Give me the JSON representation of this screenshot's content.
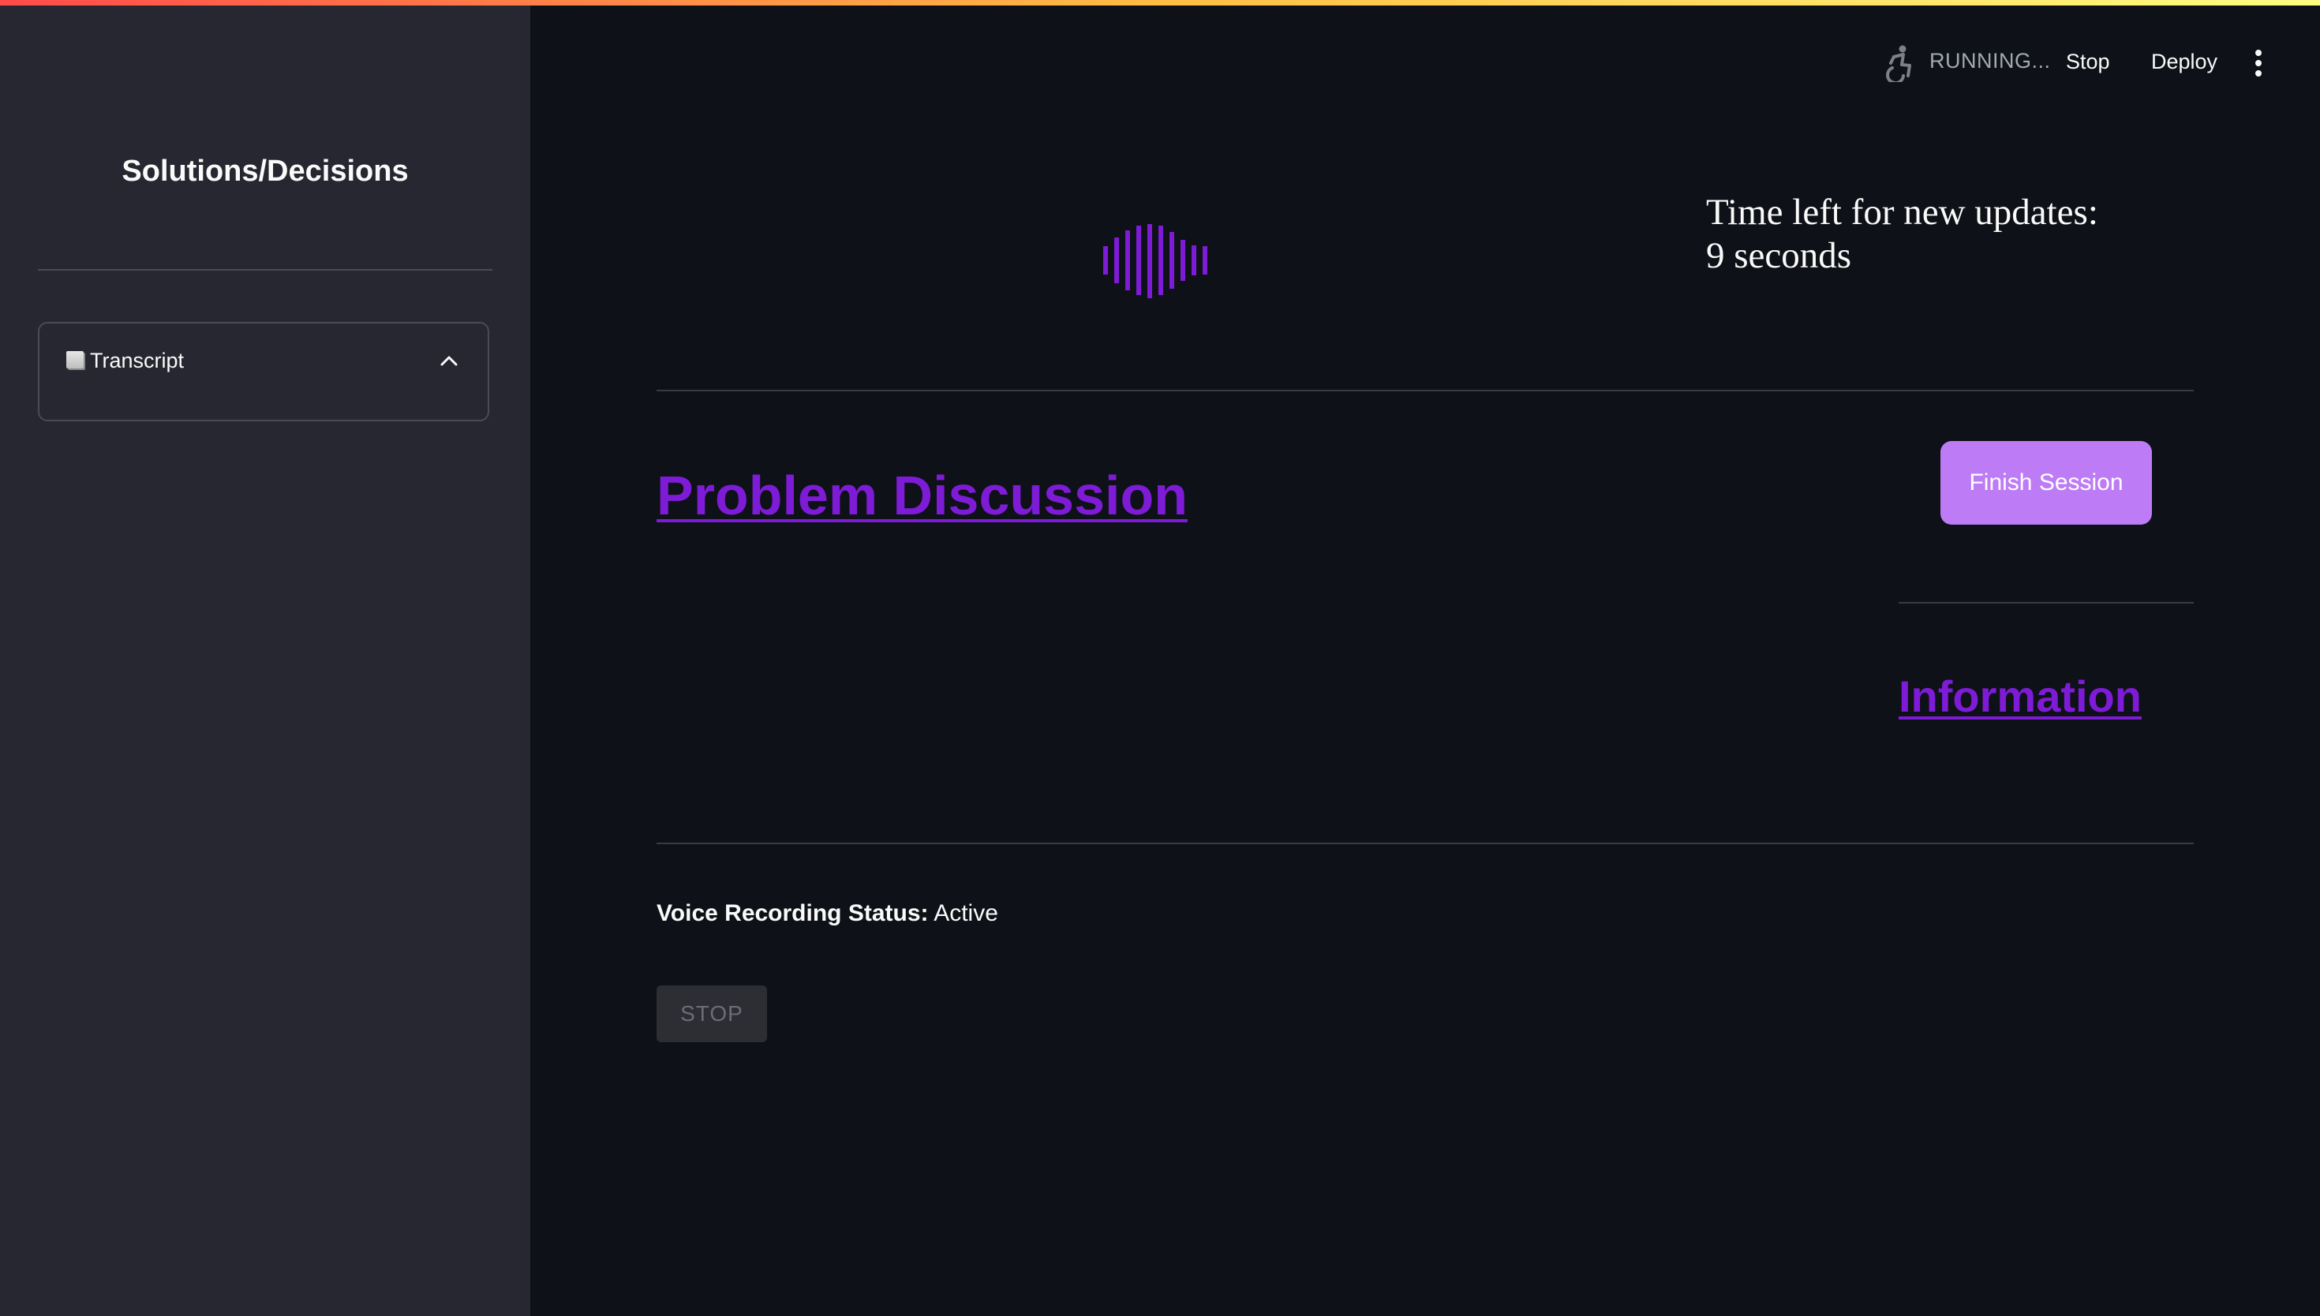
{
  "sidebar": {
    "title": "Solutions/Decisions",
    "expander": {
      "label": "Transcript",
      "icon": "page-icon",
      "state": "expanded"
    }
  },
  "toolbar": {
    "status_text": "RUNNING...",
    "status_icon": "running-person-icon",
    "stop_label": "Stop",
    "deploy_label": "Deploy",
    "menu_icon": "kebab-menu-icon"
  },
  "main": {
    "timer_line1": "Time left for new updates:",
    "timer_line2": "9 seconds",
    "problem_heading": "Problem Discussion",
    "finish_button": "Finish Session",
    "info_heading": "Information",
    "status_label": "Voice Recording Status:",
    "status_value": "Active",
    "stop_button": "STOP"
  },
  "colors": {
    "background": "#0e1117",
    "sidebar": "#262730",
    "accent_link": "#7e1bd6",
    "finish_button": "#bd7cf5",
    "waveform": "#7e1bd6"
  }
}
